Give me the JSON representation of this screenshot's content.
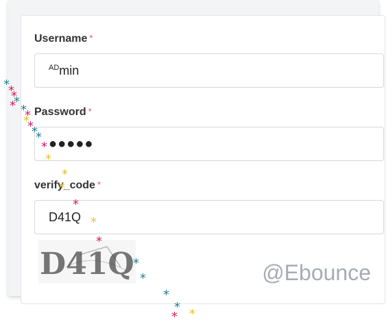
{
  "form": {
    "username": {
      "label": "Username",
      "required_mark": "*",
      "value_prefix": "AD",
      "value_rest": "min"
    },
    "password": {
      "label": "Password",
      "required_mark": "*",
      "value_masked": "●●●●●"
    },
    "verify_code": {
      "label": "verify_code",
      "required_mark": "*",
      "value": "D41Q"
    },
    "captcha_text": "D41Q"
  },
  "watermark": "@Ebounce",
  "colors": {
    "required": "#e05a4b",
    "star_teal": "#1f7f93",
    "star_pink": "#d81b60",
    "star_yellow": "#e6c229"
  }
}
